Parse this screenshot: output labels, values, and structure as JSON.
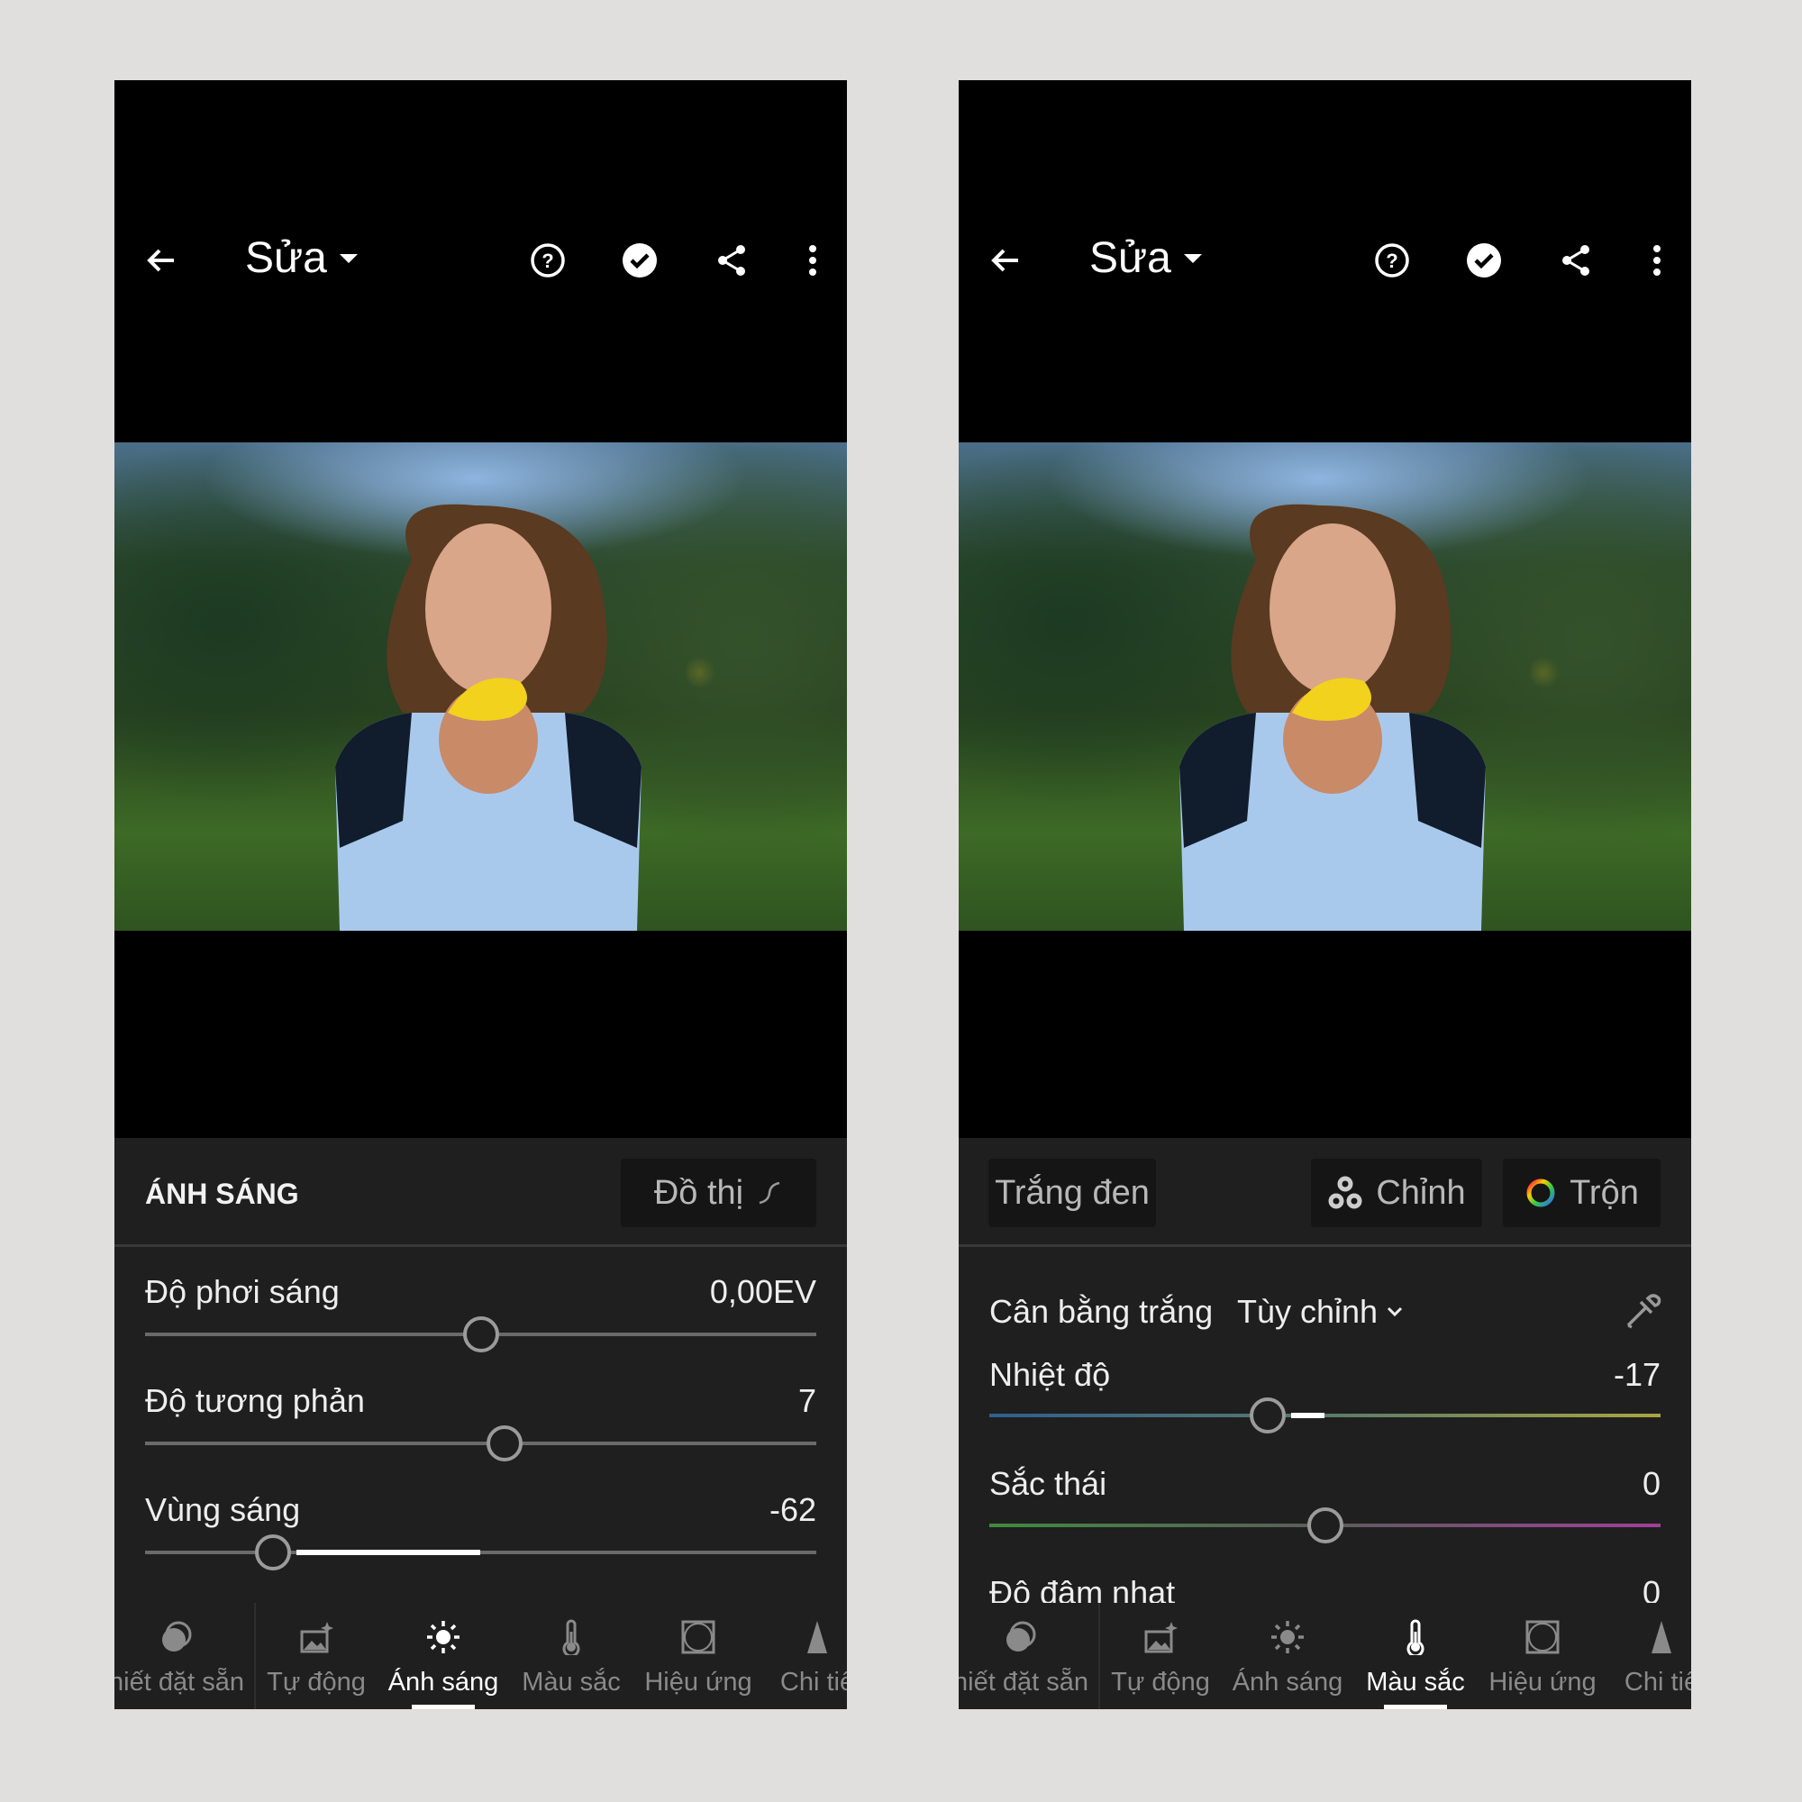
{
  "left": {
    "title": "Sửa",
    "section_title": "ÁNH SÁNG",
    "curve_button": "Đồ thị",
    "sliders": [
      {
        "label": "Độ phơi sáng",
        "value_text": "0,00EV",
        "value": 0,
        "min": -5,
        "max": 5
      },
      {
        "label": "Độ tương phản",
        "value_text": "7",
        "value": 7,
        "min": -100,
        "max": 100
      },
      {
        "label": "Vùng sáng",
        "value_text": "-62",
        "value": -62,
        "min": -100,
        "max": 100
      }
    ],
    "active_tab": 2
  },
  "right": {
    "title": "Sửa",
    "bw_button": "Trắng đen",
    "grading_button": "Chỉnh",
    "mix_button": "Trộn",
    "wb_label": "Cân bằng trắng",
    "wb_value": "Tùy chỉnh",
    "sliders": [
      {
        "label": "Nhiệt độ",
        "value_text": "-17",
        "value": -17,
        "min": -100,
        "max": 100
      },
      {
        "label": "Sắc thái",
        "value_text": "0",
        "value": 0,
        "min": -100,
        "max": 100
      },
      {
        "label": "Độ đậm nhạt",
        "value_text": "0",
        "value": 0,
        "min": -100,
        "max": 100
      }
    ],
    "active_tab": 3
  },
  "nav_tabs": [
    "hiết đặt sẵn",
    "Tự động",
    "Ánh sáng",
    "Màu sắc",
    "Hiệu ứng",
    "Chi tiế"
  ],
  "icons": {
    "back": "arrow-left-icon",
    "help": "help-circle-icon",
    "done": "check-circle-icon",
    "share": "share-icon",
    "more": "more-vertical-icon"
  },
  "colors": {
    "background": "#e0dfdd",
    "panel": "#1f1f1f",
    "temp_start": "#2f5f8f",
    "temp_end": "#a8a640",
    "tint_start": "#3f8a3f",
    "tint_end": "#a0409a"
  }
}
